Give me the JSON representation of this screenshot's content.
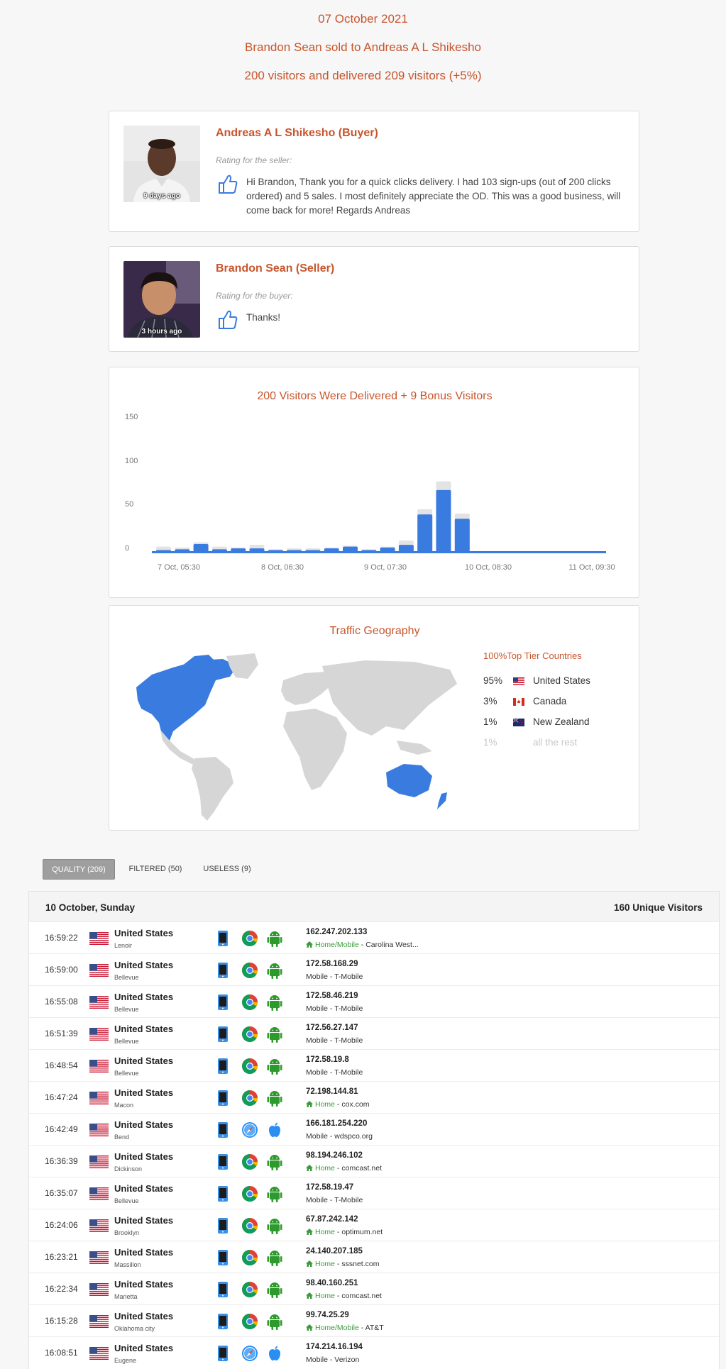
{
  "header": {
    "date": "07 October 2021",
    "deal": "Brandon Sean sold to Andreas A L Shikesho",
    "delivery": "200 visitors and delivered 209 visitors (+5%)"
  },
  "buyer_feedback": {
    "name": "Andreas A L Shikesho (Buyer)",
    "ago": "9 days ago",
    "rating_label": "Rating for the seller:",
    "text": "Hi Brandon, Thank you for a quick clicks delivery. I had 103 sign-ups (out of 200 clicks ordered) and 5 sales. I most definitely appreciate the OD. This was a good business, will come back for more! Regards Andreas"
  },
  "seller_feedback": {
    "name": "Brandon Sean (Seller)",
    "ago": "3 hours ago",
    "rating_label": "Rating for the buyer:",
    "text": "Thanks!"
  },
  "chart_data": {
    "type": "bar",
    "title": "200 Visitors Were Delivered + 9 Bonus Visitors",
    "ylim": [
      0,
      150
    ],
    "y_ticks": [
      "150",
      "100",
      "50",
      "0"
    ],
    "x_ticks": [
      "7 Oct, 05:30",
      "8 Oct, 06:30",
      "9 Oct, 07:30",
      "10 Oct, 08:30",
      "11 Oct, 09:30"
    ],
    "grid": false,
    "series": [
      {
        "name": "",
        "values": [
          2,
          3,
          9,
          3,
          4,
          4,
          2,
          2,
          2,
          4,
          6,
          2,
          5,
          8,
          43,
          71,
          38,
          0,
          0,
          0,
          0
        ]
      },
      {
        "name": "",
        "values": [
          6,
          5,
          11,
          6,
          5,
          8,
          3,
          4,
          4,
          5,
          7,
          3,
          6,
          13,
          49,
          81,
          44,
          0,
          0,
          0,
          0
        ]
      }
    ],
    "colors": {
      "delivered": "#3a7be0",
      "total": "#e3e3e3"
    }
  },
  "geo": {
    "title": "Traffic Geography",
    "top_tier_pct": "100%",
    "top_tier_label": "Top Tier Countries",
    "rows": [
      {
        "pct": "95%",
        "country": "United States",
        "flag": "us-flag"
      },
      {
        "pct": "3%",
        "country": "Canada",
        "flag": "ca-flag"
      },
      {
        "pct": "1%",
        "country": "New Zealand",
        "flag": "nz-flag"
      },
      {
        "pct": "1%",
        "country": "all the rest",
        "flag": ""
      }
    ],
    "highlight_color": "#3a7be0",
    "land_color": "#d6d6d6"
  },
  "tabs": [
    {
      "label": "QUALITY (209)",
      "active": true
    },
    {
      "label": "FILTERED (50)",
      "active": false
    },
    {
      "label": "USELESS (9)",
      "active": false
    }
  ],
  "visitors": {
    "date": "10 October, Sunday",
    "unique": "160 Unique Visitors",
    "rows": [
      {
        "time": "16:59:22",
        "country": "United States",
        "city": "Lenoir",
        "browser": "chrome",
        "os": "android",
        "ip": "162.247.202.133",
        "home": true,
        "net_type": "Home/Mobile",
        "isp": "Carolina West..."
      },
      {
        "time": "16:59:00",
        "country": "United States",
        "city": "Bellevue",
        "browser": "chrome",
        "os": "android",
        "ip": "172.58.168.29",
        "home": false,
        "net_type": "Mobile",
        "isp": "T-Mobile"
      },
      {
        "time": "16:55:08",
        "country": "United States",
        "city": "Bellevue",
        "browser": "chrome",
        "os": "android",
        "ip": "172.58.46.219",
        "home": false,
        "net_type": "Mobile",
        "isp": "T-Mobile"
      },
      {
        "time": "16:51:39",
        "country": "United States",
        "city": "Bellevue",
        "browser": "chrome",
        "os": "android",
        "ip": "172.56.27.147",
        "home": false,
        "net_type": "Mobile",
        "isp": "T-Mobile"
      },
      {
        "time": "16:48:54",
        "country": "United States",
        "city": "Bellevue",
        "browser": "chrome",
        "os": "android",
        "ip": "172.58.19.8",
        "home": false,
        "net_type": "Mobile",
        "isp": "T-Mobile"
      },
      {
        "time": "16:47:24",
        "country": "United States",
        "city": "Macon",
        "browser": "chrome",
        "os": "android",
        "ip": "72.198.144.81",
        "home": true,
        "net_type": "Home",
        "isp": "cox.com"
      },
      {
        "time": "16:42:49",
        "country": "United States",
        "city": "Bend",
        "browser": "safari",
        "os": "apple",
        "ip": "166.181.254.220",
        "home": false,
        "net_type": "Mobile",
        "isp": "wdspco.org"
      },
      {
        "time": "16:36:39",
        "country": "United States",
        "city": "Dickinson",
        "browser": "chrome",
        "os": "android",
        "ip": "98.194.246.102",
        "home": true,
        "net_type": "Home",
        "isp": "comcast.net"
      },
      {
        "time": "16:35:07",
        "country": "United States",
        "city": "Bellevue",
        "browser": "chrome",
        "os": "android",
        "ip": "172.58.19.47",
        "home": false,
        "net_type": "Mobile",
        "isp": "T-Mobile"
      },
      {
        "time": "16:24:06",
        "country": "United States",
        "city": "Brooklyn",
        "browser": "chrome",
        "os": "android",
        "ip": "67.87.242.142",
        "home": true,
        "net_type": "Home",
        "isp": "optimum.net"
      },
      {
        "time": "16:23:21",
        "country": "United States",
        "city": "Massillon",
        "browser": "chrome",
        "os": "android",
        "ip": "24.140.207.185",
        "home": true,
        "net_type": "Home",
        "isp": "sssnet.com"
      },
      {
        "time": "16:22:34",
        "country": "United States",
        "city": "Marietta",
        "browser": "chrome",
        "os": "android",
        "ip": "98.40.160.251",
        "home": true,
        "net_type": "Home",
        "isp": "comcast.net"
      },
      {
        "time": "16:15:28",
        "country": "United States",
        "city": "Oklahoma city",
        "browser": "chrome",
        "os": "android",
        "ip": "99.74.25.29",
        "home": true,
        "net_type": "Home/Mobile",
        "isp": "AT&T"
      },
      {
        "time": "16:08:51",
        "country": "United States",
        "city": "Eugene",
        "browser": "safari",
        "os": "apple",
        "ip": "174.214.16.194",
        "home": false,
        "net_type": "Mobile",
        "isp": "Verizon"
      }
    ]
  }
}
